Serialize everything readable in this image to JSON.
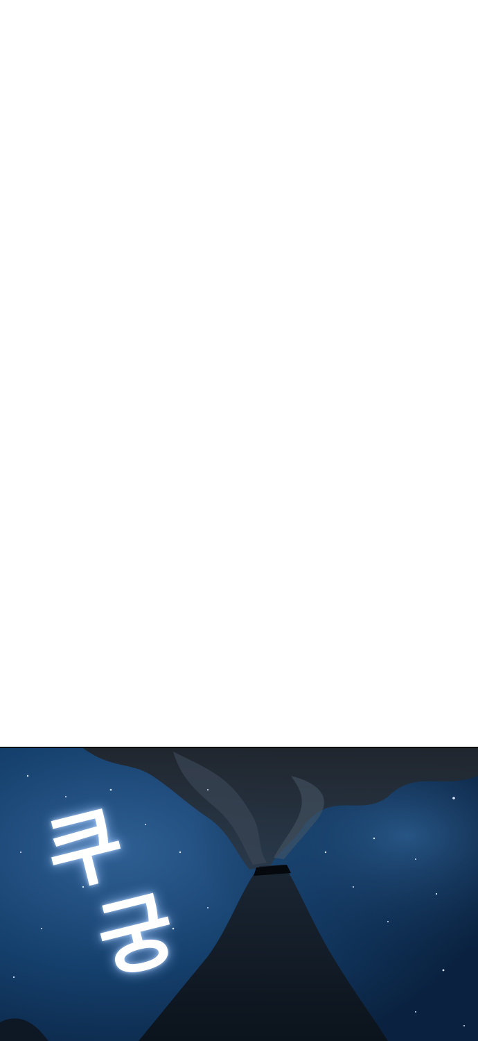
{
  "page": {
    "background_color": "#ffffff"
  },
  "panel": {
    "sky_color": "#0d2a4a",
    "glow_color": "#3a6fa6",
    "smoke_color": "#1a1f26",
    "mountain_color": "#0e1620",
    "border_color": "#000000"
  },
  "sound_effect": {
    "char1": "쿠",
    "char2": "궁"
  }
}
